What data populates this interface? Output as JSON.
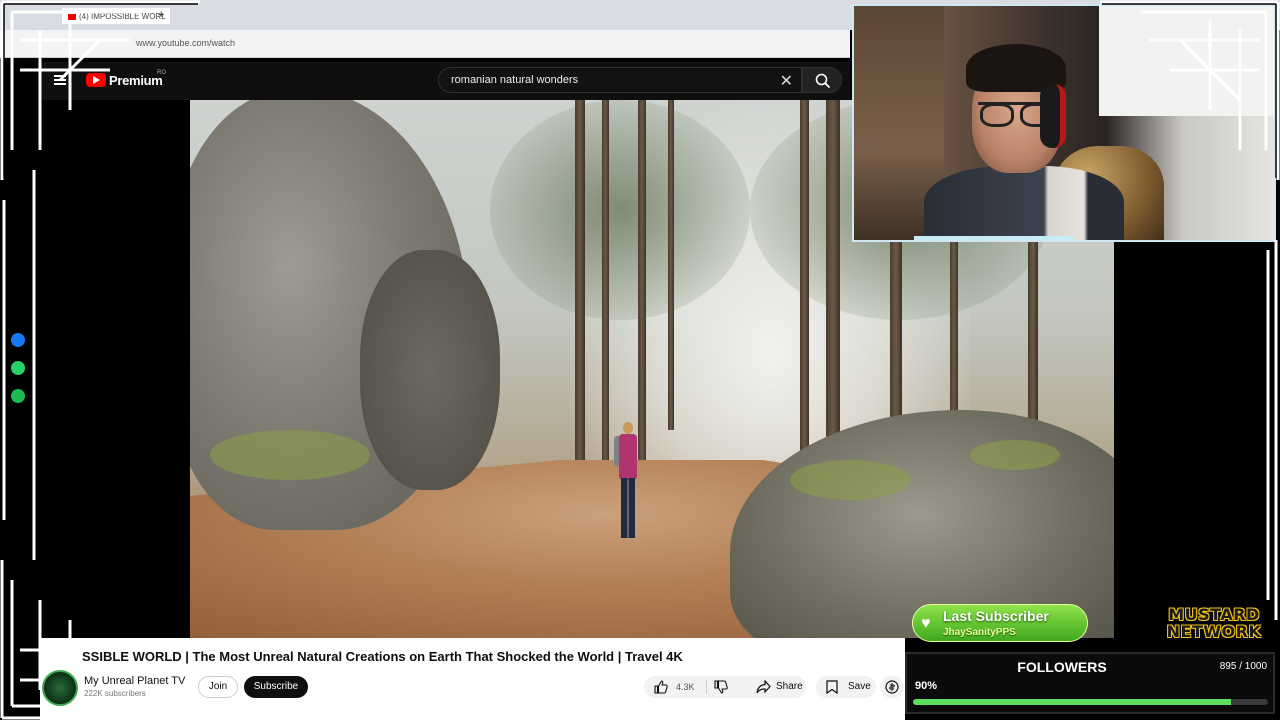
{
  "browser": {
    "tab_title": "(4) IMPOSSIBLE WORL",
    "new_tab": "+",
    "url": "www.youtube.com/watch"
  },
  "youtube": {
    "brand": "Premium",
    "country": "RO",
    "search_value": "romanian natural wonders",
    "clear_glyph": "✕"
  },
  "video": {
    "title": "SSIBLE WORLD | The Most Unreal Natural Creations on Earth That Shocked the World | Travel 4K",
    "channel": "My Unreal Planet TV",
    "subscribers": "222K subscribers",
    "join_label": "Join",
    "subscribe_label": "Subscribe",
    "like_count": "4.3K",
    "share_label": "Share",
    "save_label": "Save"
  },
  "overlay": {
    "last_subscriber_label": "Last Subscriber",
    "last_subscriber_name": "JhaySanityPPS",
    "network_line1": "MUSTARD",
    "network_line2": "NETWORK",
    "followers_label": "FOLLOWERS",
    "followers_count": "895 / 1000",
    "followers_percent_text": "90%",
    "followers_progress": 0.895
  },
  "colors": {
    "youtube_red": "#ff0000",
    "accent_green": "#5ee05a",
    "brand_mustard": "#f2c21b"
  },
  "icons": [
    "menu-icon",
    "youtube-logo-icon",
    "search-icon",
    "close-icon",
    "like-icon",
    "dislike-icon",
    "share-icon",
    "save-icon",
    "thanks-icon",
    "heart-icon",
    "messenger-icon",
    "whatsapp-icon",
    "spotify-icon"
  ]
}
